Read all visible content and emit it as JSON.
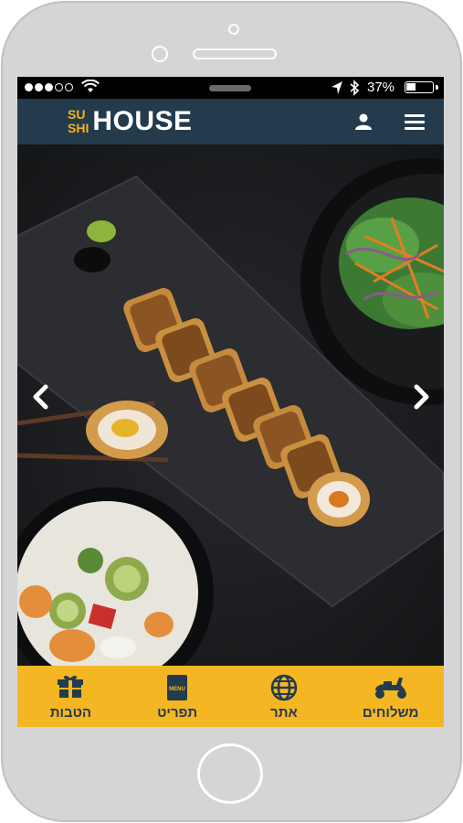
{
  "status_bar": {
    "battery_text": "37%",
    "battery_level": 0.37,
    "signal_bars_filled": 3,
    "signal_bars_total": 5
  },
  "header": {
    "logo_small_top": "SU",
    "logo_small_bottom": "SHI",
    "logo_text": "HOUSE",
    "icons": [
      "user-icon",
      "menu-icon"
    ]
  },
  "carousel": {
    "image": "sushi-rolls-on-slate-with-salads",
    "prev_icon": "chevron-left-icon",
    "next_icon": "chevron-right-icon"
  },
  "tabs": [
    {
      "label": "הטבות",
      "icon": "gift-icon"
    },
    {
      "label": "תפריט",
      "icon": "menu-book-icon"
    },
    {
      "label": "אתר",
      "icon": "globe-icon"
    },
    {
      "label": "משלוחים",
      "icon": "scooter-icon"
    }
  ],
  "menu_icon_text": "MENU",
  "colors": {
    "header_bg": "#233b4c",
    "accent": "#f5b623",
    "logo_yellow": "#f3b21f",
    "tab_text": "#233b4c"
  }
}
